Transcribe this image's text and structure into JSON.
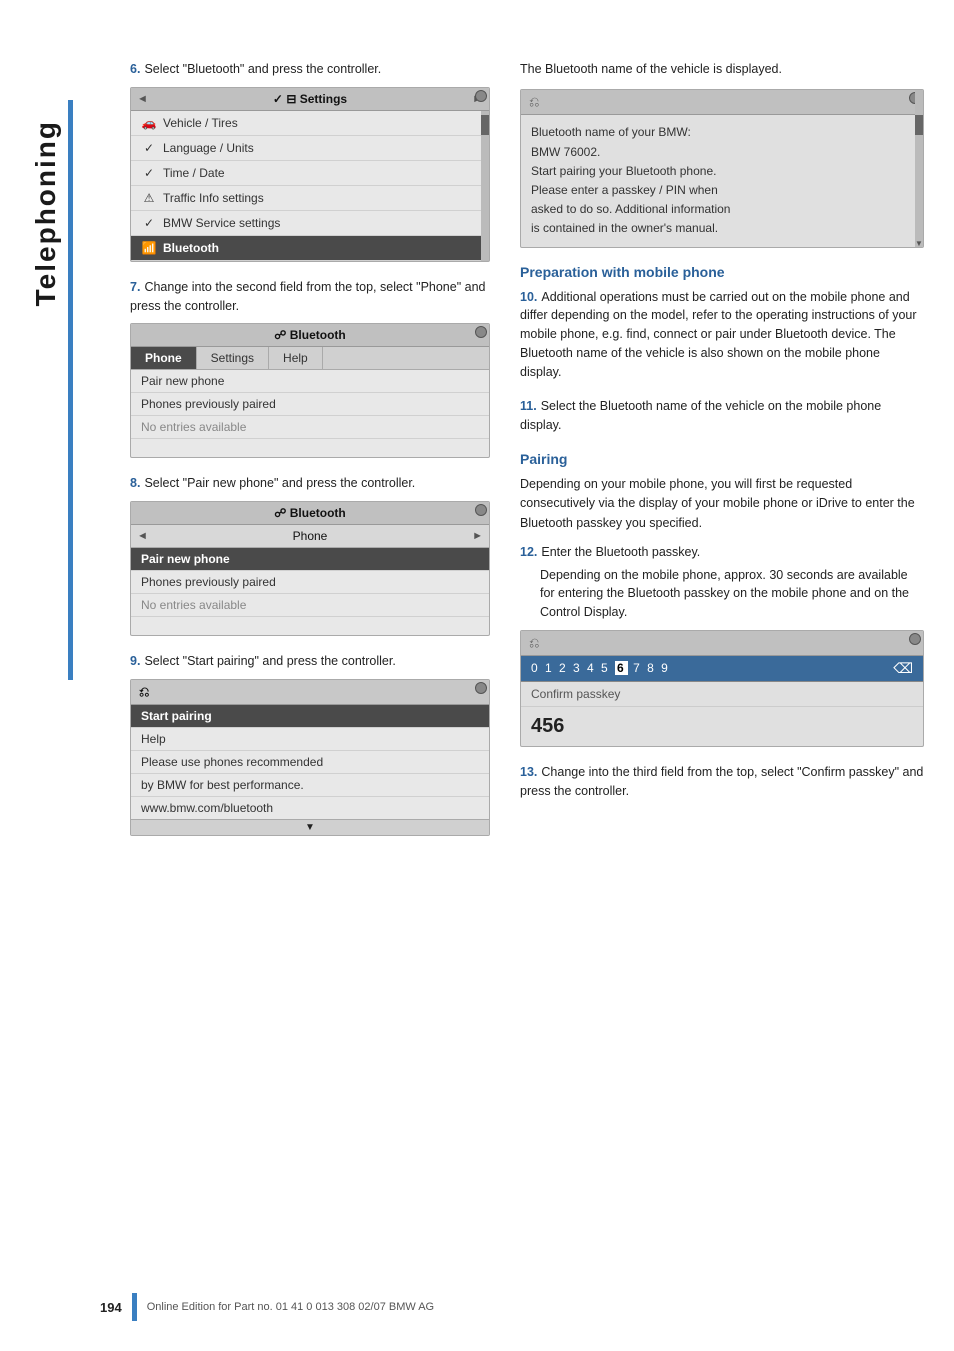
{
  "page": {
    "title": "Telephoning",
    "page_number": "194",
    "footer_text": "Online Edition for Part no. 01 41 0 013 308 02/07 BMW AG"
  },
  "sidebar": {
    "label": "Telephoning"
  },
  "steps": {
    "step6": {
      "num": "6.",
      "text": "Select \"Bluetooth\" and press the controller."
    },
    "step7": {
      "num": "7.",
      "text": "Change into the second field from the top, select \"Phone\" and press the controller."
    },
    "step8": {
      "num": "8.",
      "text": "Select \"Pair new phone\" and press the controller."
    },
    "step9": {
      "num": "9.",
      "text": "Select \"Start pairing\" and press the controller."
    },
    "step10": {
      "num": "10.",
      "text": "Additional operations must be carried out on the mobile phone and differ depending on the model, refer to the operating instructions of your mobile phone, e.g. find, connect or pair under Bluetooth device. The Bluetooth name of the vehicle is also shown on the mobile phone display."
    },
    "step11": {
      "num": "11.",
      "text": "Select the Bluetooth name of the vehicle on the mobile phone display."
    },
    "step12": {
      "num": "12.",
      "text": "Enter the Bluetooth passkey.",
      "detail": "Depending on the mobile phone, approx. 30 seconds are available for entering the Bluetooth passkey on the mobile phone and on the Control Display."
    },
    "step13": {
      "num": "13.",
      "text": "Change into the third field from the top, select \"Confirm passkey\" and press the controller."
    }
  },
  "ui_boxes": {
    "settings_menu": {
      "header": "« ✓ Settings »",
      "items": [
        {
          "icon": "🚗",
          "label": "Vehicle / Tires",
          "checked": true
        },
        {
          "icon": "⚙",
          "label": "Language / Units",
          "checked": true
        },
        {
          "icon": "🕐",
          "label": "Time / Date",
          "checked": true
        },
        {
          "icon": "⚠",
          "label": "Traffic Info settings",
          "checked": true
        },
        {
          "icon": "★",
          "label": "BMW Service settings",
          "checked": true
        },
        {
          "icon": "📶",
          "label": "Bluetooth",
          "highlighted": true
        }
      ]
    },
    "bluetooth_phone_menu": {
      "header": "Bluetooth",
      "tabs": [
        "Phone",
        "Settings",
        "Help"
      ],
      "active_tab": "Phone",
      "items": [
        {
          "label": "Pair new phone"
        },
        {
          "label": "Phones previously paired"
        },
        {
          "label": "No entries available",
          "sub": true
        }
      ]
    },
    "bluetooth_phone_menu2": {
      "header": "Bluetooth",
      "sub_header": "« Phone »",
      "items": [
        {
          "label": "Pair new phone",
          "highlighted": true
        },
        {
          "label": "Phones previously paired"
        },
        {
          "label": "No entries available",
          "sub": true
        }
      ]
    },
    "start_pairing_menu": {
      "items": [
        {
          "label": "Start pairing",
          "highlighted": true
        },
        {
          "label": "Help"
        },
        {
          "label": "Please use phones recommended"
        },
        {
          "label": "by BMW for best performance."
        },
        {
          "label": "www.bmw.com/bluetooth"
        }
      ]
    },
    "bluetooth_name_display": {
      "lines": [
        "Bluetooth name of your BMW:",
        "BMW 76002.",
        "Start pairing your Bluetooth phone.",
        "Please enter a passkey / PIN when",
        "asked to do so. Additional information",
        "is contained in the owner's manual."
      ]
    },
    "passkey_display": {
      "numbers": "0 1 2 3 4 5 6 7 8 9",
      "highlighted": "6",
      "confirm_label": "Confirm passkey",
      "value": "456"
    }
  },
  "sections": {
    "preparation_heading": "Preparation with mobile phone",
    "pairing_heading": "Pairing",
    "pairing_intro": "Depending on your mobile phone, you will first be requested consecutively via the display of your mobile phone or iDrive to enter the Bluetooth passkey you specified."
  }
}
